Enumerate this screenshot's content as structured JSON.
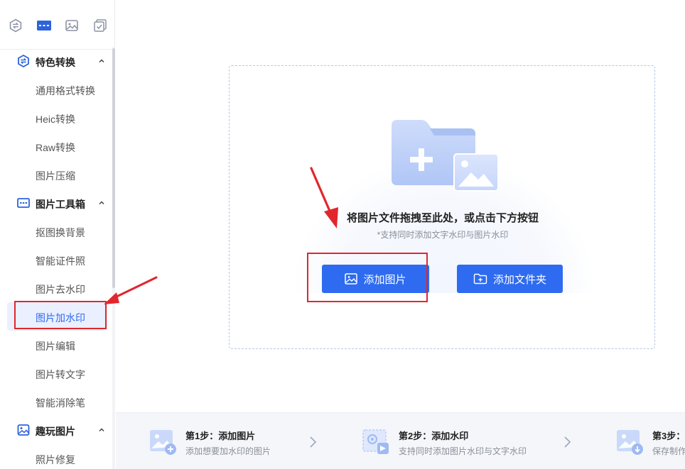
{
  "sidebar": {
    "top_icons": [
      "convert-icon",
      "toolbox-icon",
      "image-icon",
      "checklist-icon"
    ],
    "groups": [
      {
        "label": "特色转换",
        "icon": "convert-icon",
        "items": [
          "通用格式转换",
          "Heic转换",
          "Raw转换",
          "图片压缩"
        ]
      },
      {
        "label": "图片工具箱",
        "icon": "toolbox-icon",
        "items": [
          "抠图换背景",
          "智能证件照",
          "图片去水印",
          "图片加水印",
          "图片编辑",
          "图片转文字",
          "智能消除笔"
        ]
      },
      {
        "label": "趣玩图片",
        "icon": "image-icon",
        "items": [
          "照片修复"
        ]
      }
    ],
    "active_item": "图片加水印"
  },
  "main": {
    "drop_title": "将图片文件拖拽至此处，或点击下方按钮",
    "drop_subtitle": "*支持同时添加文字水印与图片水印",
    "add_image_button": "添加图片",
    "add_folder_button": "添加文件夹"
  },
  "footer": {
    "steps": [
      {
        "title": "第1步：添加图片",
        "desc": "添加想要加水印的图片"
      },
      {
        "title": "第2步：添加水印",
        "desc": "支持同时添加图片水印与文字水印"
      },
      {
        "title": "第3步：",
        "desc": "保存制作"
      }
    ]
  },
  "colors": {
    "accent": "#2e6bf0",
    "active_bg": "#eaf0ff",
    "annotation": "#e1262d"
  }
}
